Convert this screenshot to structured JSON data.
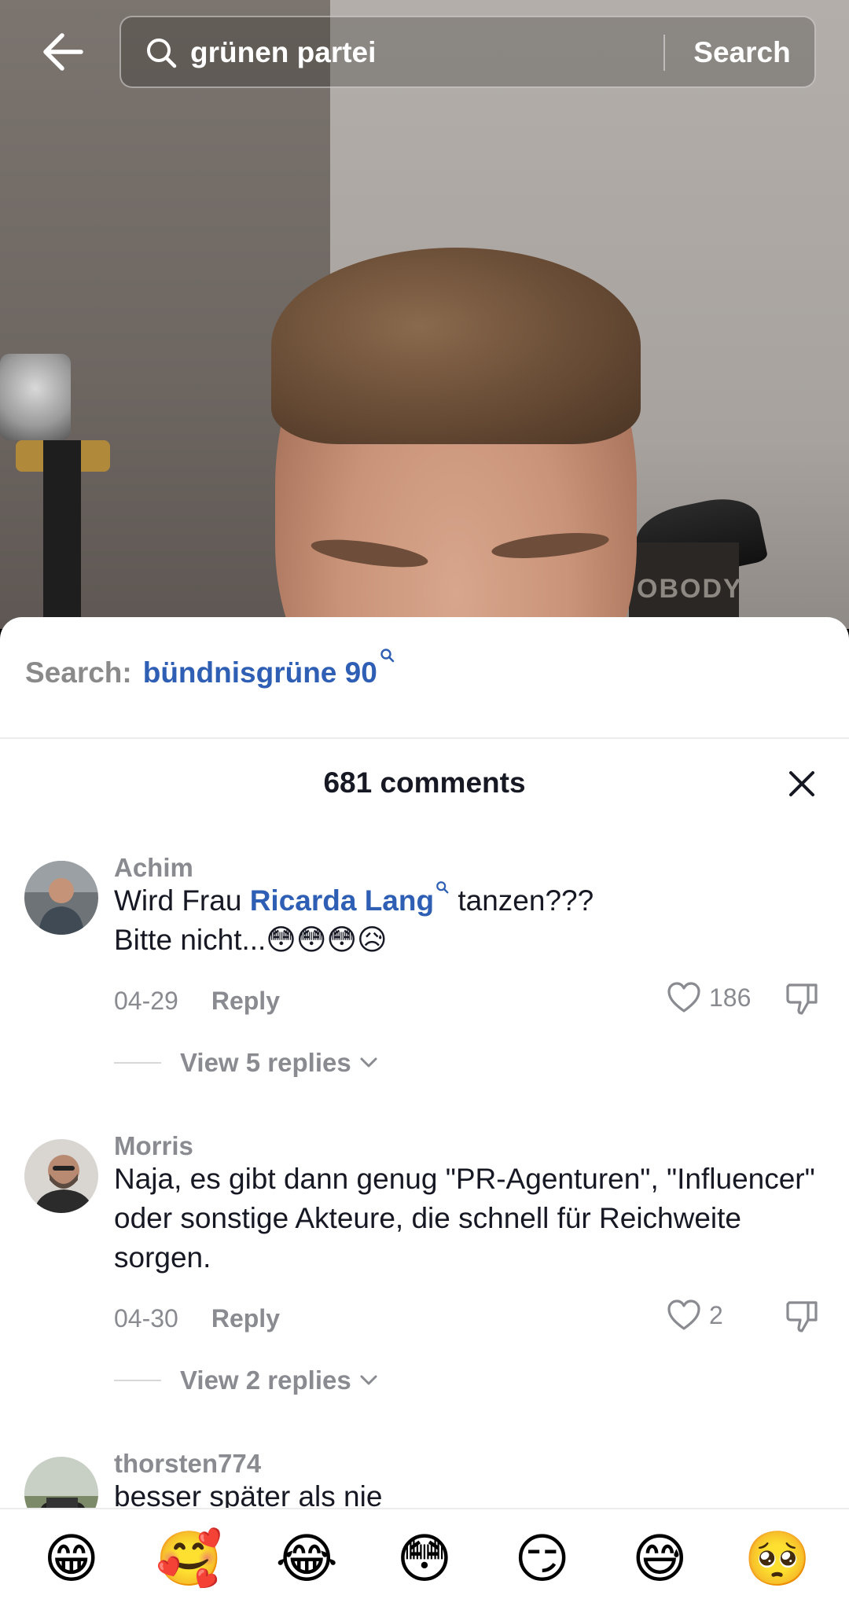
{
  "search": {
    "query": "grünen partei",
    "button_label": "Search"
  },
  "video": {
    "poster_text": "OBODY"
  },
  "suggestion": {
    "label": "Search:",
    "keyword": "bündnisgrüne 90"
  },
  "comments_header": {
    "count_label": "681 comments"
  },
  "comments": [
    {
      "username": "Achim",
      "text_before": "Wird Frau ",
      "mention": "Ricarda Lang",
      "text_after": " tanzen???",
      "text_line2": "Bitte nicht...😳😳😳😥",
      "date": "04-29",
      "reply_label": "Reply",
      "likes": "186",
      "view_replies": "View 5 replies"
    },
    {
      "username": "Morris",
      "text": "Naja, es gibt dann genug \"PR-Agenturen\", \"Influencer\" oder sonstige Akteure, die schnell für Reichweite sorgen.",
      "date": "04-30",
      "reply_label": "Reply",
      "likes": "2",
      "view_replies": "View 2 replies"
    },
    {
      "username": "thorsten774",
      "text": "besser später als nie"
    }
  ],
  "emoji_bar": [
    "😁",
    "🥰",
    "😂",
    "😳",
    "😏",
    "😅",
    "🥺"
  ],
  "colors": {
    "accent_link": "#2e5fb4",
    "text_primary": "#161823",
    "text_secondary": "#8a8b91"
  }
}
